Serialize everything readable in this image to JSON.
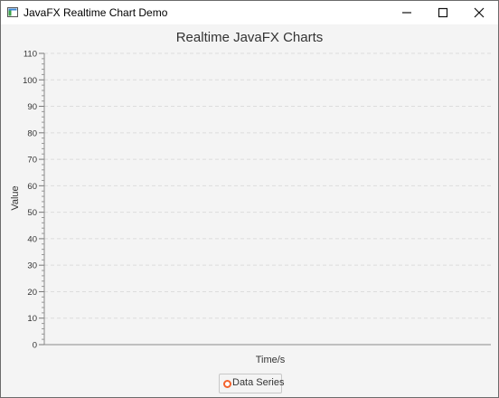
{
  "window": {
    "title": "JavaFX Realtime Chart Demo",
    "controls": [
      "minimize-icon",
      "maximize-icon",
      "close-icon"
    ]
  },
  "chart_data": {
    "type": "line",
    "title": "Realtime JavaFX Charts",
    "xlabel": "Time/s",
    "ylabel": "Value",
    "ylim": [
      0,
      110
    ],
    "yticks": [
      "0",
      "10",
      "20",
      "30",
      "40",
      "50",
      "60",
      "70",
      "80",
      "90",
      "100",
      "110"
    ],
    "grid": true,
    "series": [
      {
        "name": "Data Series",
        "color": "#f3622d",
        "values": []
      }
    ],
    "legend": "bottom"
  }
}
